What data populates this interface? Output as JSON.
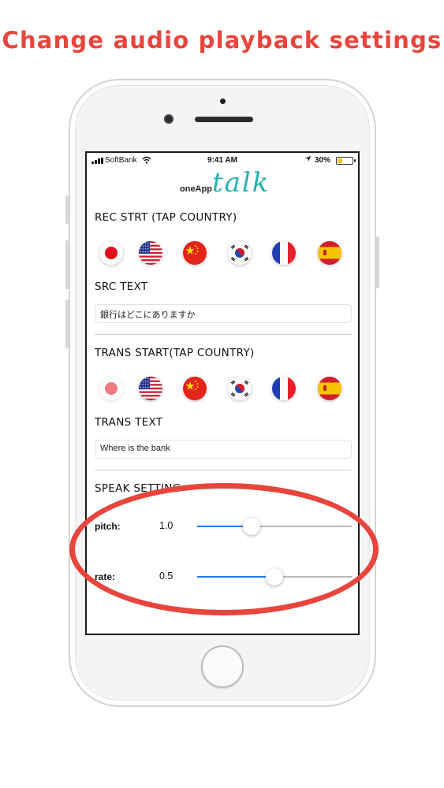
{
  "headline": "Change audio playback settings",
  "status_bar": {
    "carrier": "SoftBank",
    "time": "9:41 AM",
    "battery": "30%",
    "battery_level": 0.3
  },
  "logo": {
    "prefix": "oneApp",
    "word": "talk"
  },
  "rec_section": {
    "title": "REC STRT (TAP COUNTRY)",
    "flags": [
      "japan",
      "usa",
      "china",
      "korea",
      "france",
      "spain"
    ]
  },
  "src_text": {
    "title": "SRC TEXT",
    "value": "銀行はどこにありますか"
  },
  "trans_section": {
    "title": "TRANS START(TAP COUNTRY)",
    "flags": [
      "japan",
      "usa",
      "china",
      "korea",
      "france",
      "spain"
    ]
  },
  "trans_text": {
    "title": "TRANS TEXT",
    "value": "Where is the bank"
  },
  "speak_setting": {
    "title": "SPEAK SETTING",
    "pitch": {
      "label": "pitch:",
      "value": "1.0",
      "fraction": 0.35
    },
    "rate": {
      "label": "rate:",
      "value": "0.5",
      "fraction": 0.5
    }
  },
  "colors": {
    "headline": "#e8453c",
    "logo": "#21b3b0",
    "slider_fill": "#1e7cf0",
    "highlight": "#e8453c"
  }
}
